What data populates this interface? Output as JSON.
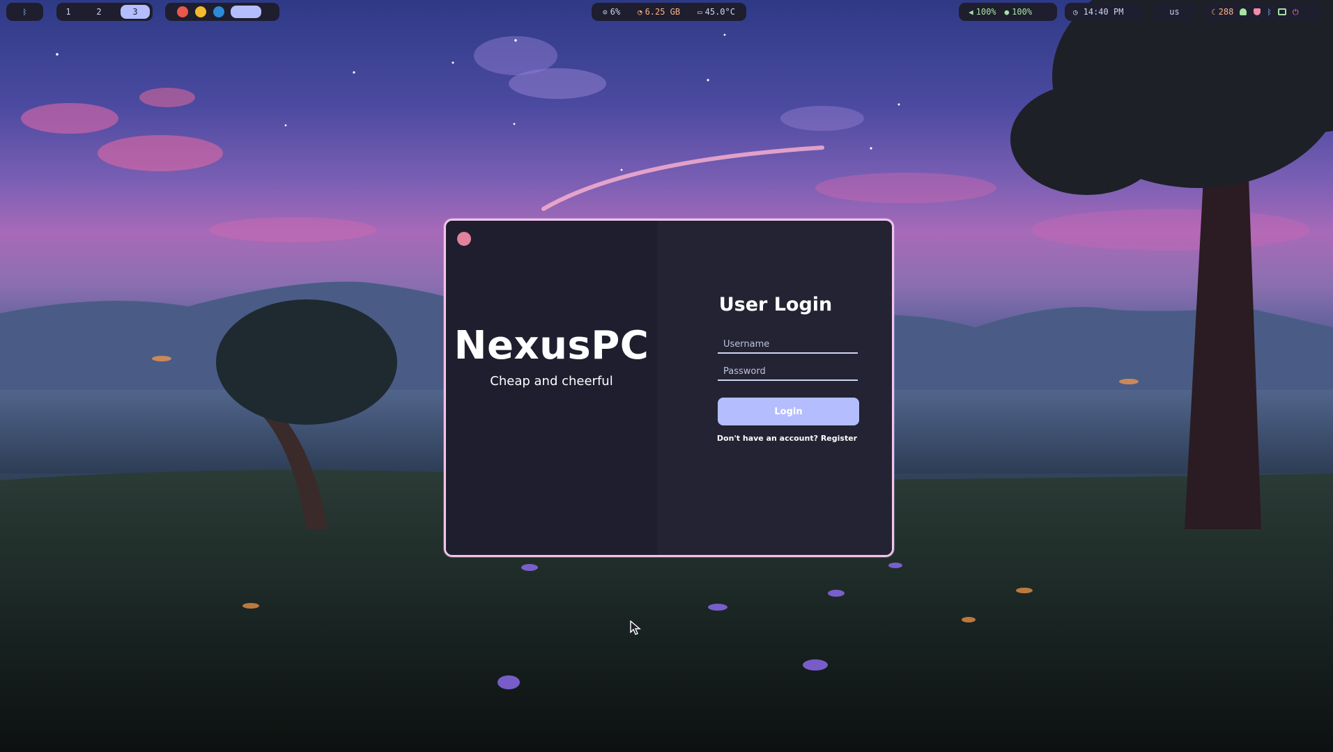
{
  "screen": {
    "background": "night-meadow-wallpaper"
  },
  "top_bar": {
    "bluetooth": {
      "icon": "bluetooth-icon"
    },
    "workspaces": [
      "1",
      "2",
      "3"
    ],
    "active_workspace": "3",
    "apps": [
      {
        "name": "firefox-icon",
        "color": "#e9584a"
      },
      {
        "name": "sun-app-icon",
        "color": "#f5b82e"
      },
      {
        "name": "vscode-icon",
        "color": "#2d8ad6"
      },
      {
        "name": "active-window-icon",
        "color": "#b4befe"
      }
    ],
    "system": {
      "cpu": "6%",
      "memory": "6.25 GB",
      "temperature": "45.0°C"
    },
    "audio": {
      "volume": "100%",
      "mic": "100%"
    },
    "clock": "14:40 PM",
    "keyboard_layout": "us",
    "updates": "288",
    "colors": {
      "bar_bg": "#1e1e2e",
      "accent": "#b4befe",
      "green": "#a6e3a1",
      "peach": "#fab387",
      "red": "#f38ba8",
      "blue": "#89b4fa"
    }
  },
  "login": {
    "brand": "NexusPC",
    "tagline": "Cheap and cheerful",
    "heading": "User Login",
    "username_placeholder": "Username",
    "password_placeholder": "Password",
    "login_label": "Login",
    "register_prompt": "Don't have an account? ",
    "register_link": "Register",
    "colors": {
      "border": "#f5c2e7",
      "panel_left": "#1e1e2e",
      "panel_right": "#242333",
      "button": "#b4befe",
      "close_dot": "#f38ba8"
    }
  }
}
